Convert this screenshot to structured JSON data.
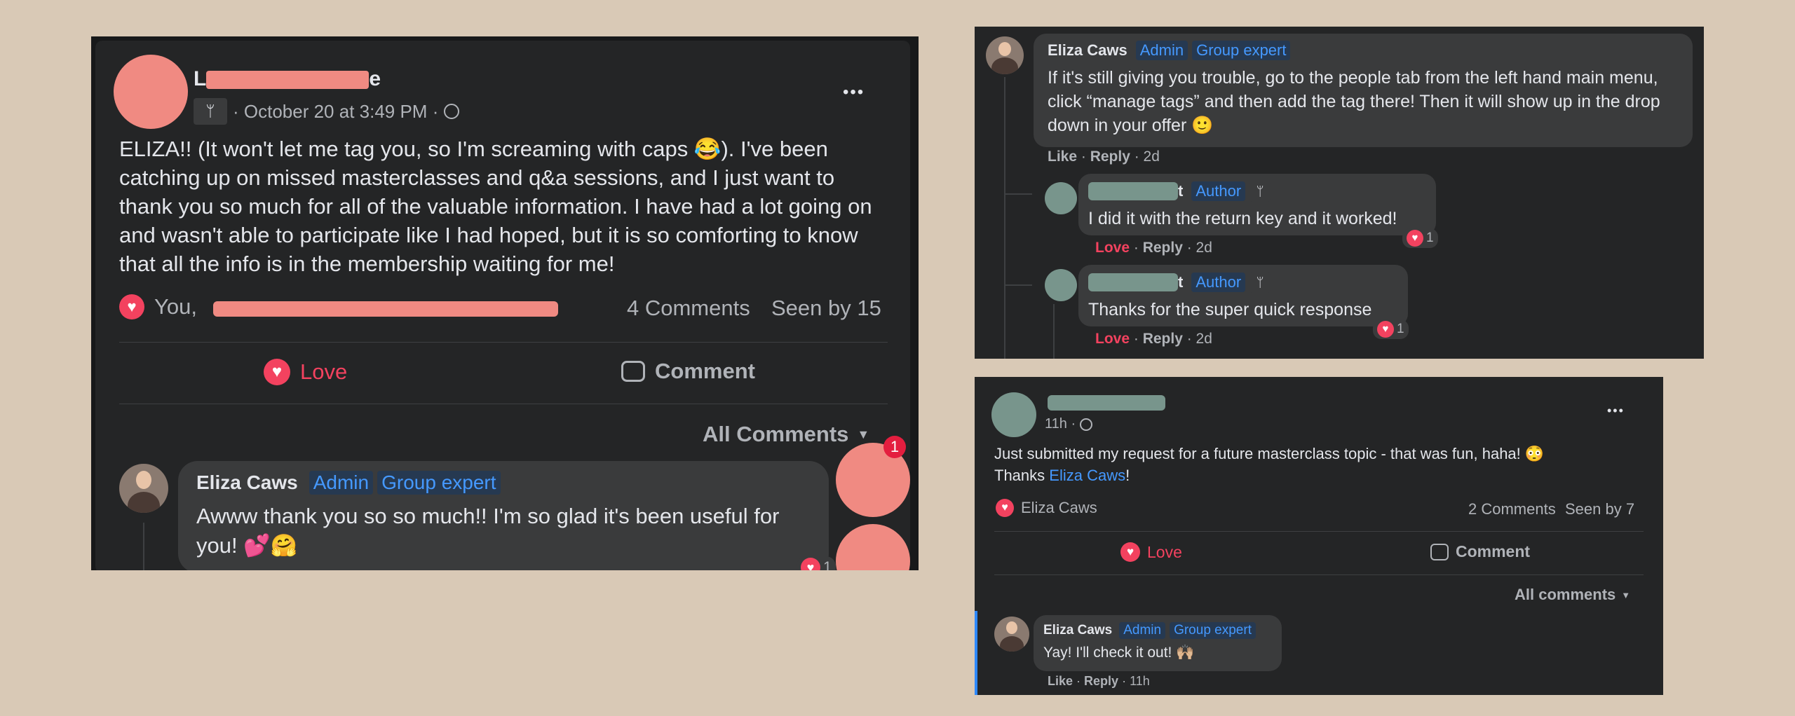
{
  "post1": {
    "author_first": "L",
    "author_last": "e",
    "date": "· October 20 at 3:49 PM ·",
    "more": "•••",
    "body": "ELIZA!! (It won't let me tag you, so I'm screaming with caps 😂). I've been catching up on missed masterclasses and q&a sessions, and I just want to thank you so much for all of the valuable information. I have had a lot going on and wasn't able to participate like I had hoped, but it is so comforting to know that all the info is in the membership waiting for me!",
    "reactors": "You,",
    "comments_count": "4 Comments",
    "seen_by": "Seen by 15",
    "love_label": "Love",
    "comment_label": "Comment",
    "all_comments": "All Comments",
    "notif_badge": "1",
    "reply": {
      "name": "Eliza Caws",
      "badge_admin": "Admin",
      "badge_expert": "Group expert",
      "text": "Awww thank you so so much!! I'm so glad it's been useful for you! 💕🤗",
      "reaction_count": "1"
    }
  },
  "thread": {
    "comment": {
      "name": "Eliza Caws",
      "badge_admin": "Admin",
      "badge_expert": "Group expert",
      "text": "If it's still giving you trouble, go to the people tab from the left hand main menu, click “manage tags” and then add the tag there! Then it will show up in the drop down in your offer 🙂",
      "like": "Like",
      "reply": "Reply",
      "time": "· 2d"
    },
    "replies": [
      {
        "name_end": "t",
        "badge": "Author",
        "text": "I did it with the return key and it worked!",
        "love": "Love",
        "reply": "Reply",
        "time": "· 2d",
        "reaction_count": "1"
      },
      {
        "name_end": "t",
        "badge": "Author",
        "text": "Thanks for the super quick response",
        "love": "Love",
        "reply": "Reply",
        "time": "· 2d",
        "reaction_count": "1"
      }
    ]
  },
  "post2": {
    "time": "11h ·",
    "more": "•••",
    "text_line1": "Just submitted my request for a future masterclass topic - that was fun, haha! 😳",
    "text_thanks": "Thanks",
    "mention": "Eliza Caws",
    "text_end": "!",
    "reactors": "Eliza Caws",
    "comments_count": "2 Comments",
    "seen_by": "Seen by 7",
    "love_label": "Love",
    "comment_label": "Comment",
    "all_comments": "All comments",
    "reply": {
      "name": "Eliza Caws",
      "badge_admin": "Admin",
      "badge_expert": "Group expert",
      "text": "Yay! I'll check it out! 🙌🏼",
      "like": "Like",
      "reply": "Reply",
      "time": "· 11h"
    }
  },
  "colors": {
    "background": "#d9c9b6",
    "panel": "#18191a",
    "card": "#242526",
    "bubble": "#3a3b3c",
    "accent_pink": "#f3425f",
    "accent_blue": "#4599ff",
    "redaction_pink": "#f08a82",
    "redaction_teal": "#78958c"
  }
}
